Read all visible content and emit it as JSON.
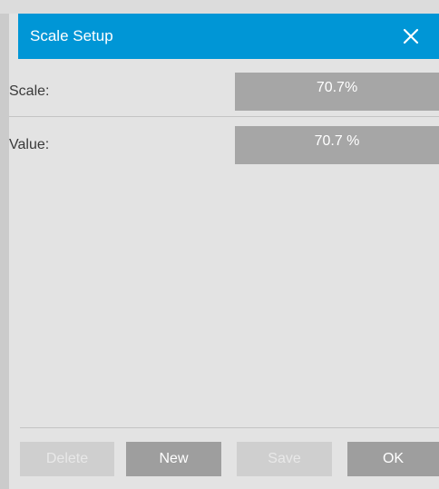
{
  "dialog": {
    "title": "Scale Setup"
  },
  "fields": {
    "scale_label": "Scale:",
    "scale_value": "70.7%",
    "value_label": "Value:",
    "value_value": "70.7 %"
  },
  "buttons": {
    "delete_label": "Delete",
    "new_label": "New",
    "save_label": "Save",
    "ok_label": "OK"
  },
  "icons": {
    "close": "close-icon"
  },
  "colors": {
    "titlebar": "#0096d6",
    "value_box": "#a6a6a6",
    "button_enabled": "#9e9e9e",
    "button_disabled": "#cfcfcf"
  }
}
